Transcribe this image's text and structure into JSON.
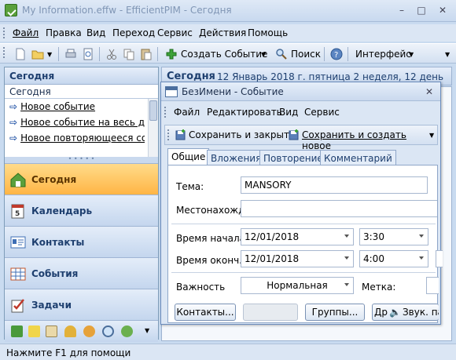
{
  "window": {
    "title": "My Information.effw - EfficientPIM - Сегодня",
    "controls": [
      "–",
      "□",
      "✕"
    ]
  },
  "menu": [
    "Файл",
    "Правка",
    "Вид",
    "Переход",
    "Сервис",
    "Действия",
    "Помощь"
  ],
  "toolbar": {
    "create_event": "Создать Событие",
    "search": "Поиск",
    "interface": "Интерфейс"
  },
  "left": {
    "header": "Сегодня",
    "subheader": "Сегодня",
    "quick_items": [
      "Новое событие",
      "Новое событие на весь де",
      "Новое повторяющееся со"
    ],
    "nav": [
      "Сегодня",
      "Календарь",
      "Контакты",
      "События",
      "Задачи"
    ]
  },
  "right_header": {
    "title": "Сегодня",
    "date": "12 Январь 2018 г. пятница   2 неделя, 12 день"
  },
  "status": "Нажмите F1 для помощи",
  "dialog": {
    "title": "БезИмени - Событие",
    "close": "✕",
    "menu": [
      "Файл",
      "Редактировать",
      "Вид",
      "Сервис"
    ],
    "save_close": "Сохранить и закрыть",
    "save_new": "Сохранить и создать новое",
    "tabs": [
      "Общие",
      "Вложения",
      "Повторение",
      "Комментарий"
    ],
    "form": {
      "topic_label": "Тема:",
      "topic_value": "MANSORY",
      "location_label": "Местонахождение:",
      "location_value": "",
      "start_label": "Время начала:",
      "start_date": "12/01/2018",
      "start_time": "3:30",
      "end_label": "Время оконч.:",
      "end_date": "12/01/2018",
      "end_time": "4:00",
      "importance_label": "Важность",
      "importance_value": "Нормальная",
      "mark_label": "Метка:"
    },
    "buttons": {
      "contacts": "Контакты...",
      "groups": "Группы...",
      "d_btn": "Др",
      "sound": "Звук. пар"
    }
  }
}
